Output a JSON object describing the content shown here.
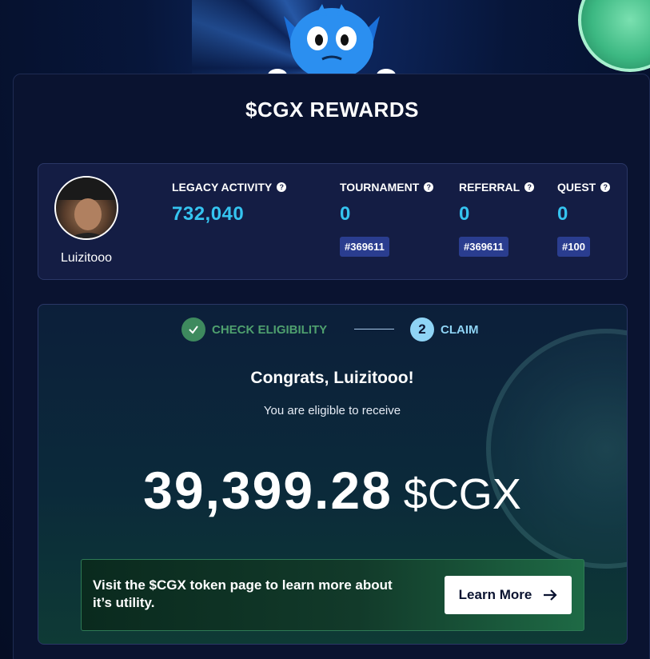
{
  "page": {
    "title": "$CGX REWARDS"
  },
  "profile": {
    "username": "Luizitooo"
  },
  "stats": [
    {
      "label": "LEGACY ACTIVITY",
      "value": "732,040",
      "rank": ""
    },
    {
      "label": "TOURNAMENT",
      "value": "0",
      "rank": "#369611"
    },
    {
      "label": "REFERRAL",
      "value": "0",
      "rank": "#369611"
    },
    {
      "label": "QUEST",
      "value": "0",
      "rank": "#100"
    }
  ],
  "steps": {
    "step1": {
      "label": "CHECK ELIGIBILITY"
    },
    "step2": {
      "number": "2",
      "label": "CLAIM"
    }
  },
  "claim": {
    "congrats": "Congrats, Luizitooo!",
    "eligible_text": "You are eligible to receive",
    "amount": "39,399.28",
    "unit": "$CGX"
  },
  "banner": {
    "text": "Visit the $CGX token page to learn more about it’s utility.",
    "button_label": "Learn More",
    "button_icon": "arrow-right-icon"
  },
  "colors": {
    "accent": "#35c4f0",
    "success": "#3e8a5e",
    "badge": "#2a3d8f"
  }
}
